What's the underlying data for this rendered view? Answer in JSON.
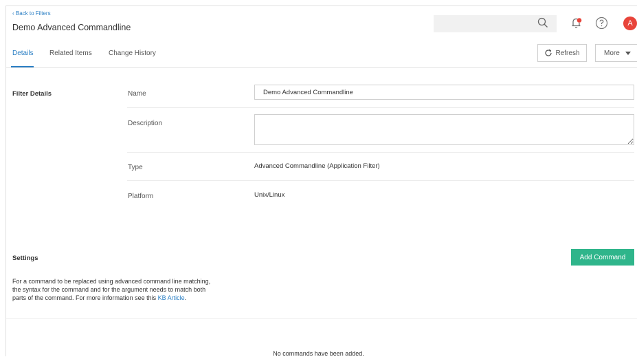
{
  "header": {
    "back_link": "‹ Back to Filters",
    "title": "Demo Advanced Commandline",
    "search_placeholder": "",
    "avatar_initial": "A",
    "accent_color": "#2b7fc4",
    "avatar_color": "#e8443a"
  },
  "tabs": [
    {
      "label": "Details",
      "active": true
    },
    {
      "label": "Related Items",
      "active": false
    },
    {
      "label": "Change History",
      "active": false
    }
  ],
  "toolbar": {
    "refresh_label": "Refresh",
    "more_label": "More"
  },
  "filter_details": {
    "section_title": "Filter Details",
    "name_label": "Name",
    "name_value": "Demo Advanced Commandline",
    "description_label": "Description",
    "description_value": "",
    "type_label": "Type",
    "type_value": "Advanced Commandline (Application Filter)",
    "platform_label": "Platform",
    "platform_value": "Unix/Linux"
  },
  "settings": {
    "section_title": "Settings",
    "add_button_label": "Add Command",
    "add_button_color": "#2fb58b",
    "description": "For a command to be replaced using advanced command line matching, the syntax for the command and for the argument needs to match both parts of the command. For more information see this ",
    "kb_link": "KB Article",
    "description_end": ".",
    "empty_message": "No commands have been added."
  }
}
